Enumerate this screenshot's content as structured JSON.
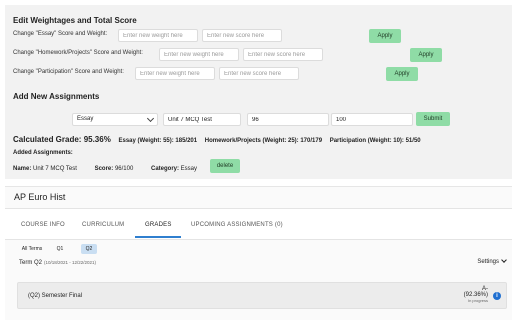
{
  "weightage": {
    "heading": "Edit Weightages and Total Score",
    "rows": [
      {
        "label": "Change \"Essay\" Score and Weight:",
        "weight_placeholder": "Enter new weight here",
        "score_placeholder": "Enter new score here",
        "apply_label": "Apply"
      },
      {
        "label": "Change \"Homework/Projects\" Score and Weight:",
        "weight_placeholder": "Enter new weight here",
        "score_placeholder": "Enter new score here",
        "apply_label": "Apply"
      },
      {
        "label": "Change \"Participation\" Score and Weight:",
        "weight_placeholder": "Enter new weight here",
        "score_placeholder": "Enter new score here",
        "apply_label": "Apply"
      }
    ]
  },
  "new_assignment": {
    "heading": "Add New Assignments",
    "category_value": "Essay",
    "name_value": "Unit 7 MCQ Test",
    "score_value": "96",
    "total_value": "100",
    "submit_label": "Submit"
  },
  "calculated": {
    "grade_text": "Calculated Grade: 95.36%",
    "essay": "Essay (Weight: 55): 185/201",
    "homework": "Homework/Projects (Weight: 25): 170/179",
    "participation": "Participation (Weight: 10): 51/50"
  },
  "added": {
    "title": "Added Assignments:",
    "name_label": "Name:",
    "name_value": "Unit 7 MCQ Test",
    "score_label": "Score:",
    "score_value": "96/100",
    "category_label": "Category:",
    "category_value": "Essay",
    "delete_label": "delete"
  },
  "course": {
    "title": "AP Euro Hist",
    "tabs": [
      {
        "label": "COURSE INFO"
      },
      {
        "label": "CURRICULUM"
      },
      {
        "label": "GRADES"
      },
      {
        "label": "UPCOMING ASSIGNMENTS (0)"
      }
    ],
    "active_tab": "GRADES",
    "terms": [
      "All Terms",
      "Q1",
      "Q2"
    ],
    "active_term": "Q2",
    "term_label": "Term Q2",
    "term_dates": "(10/18/2021 - 12/22/2021)",
    "settings_label": "Settings",
    "semester": {
      "name": "(Q2) Semester Final",
      "letter": "A-",
      "percent": "(92.36%)",
      "status": "In progress"
    }
  },
  "colors": {
    "apply_button": "#8fdca6",
    "active_tab_underline": "#2f7fcf",
    "active_term": "#c9def2",
    "info_icon": "#1f6fd0"
  }
}
